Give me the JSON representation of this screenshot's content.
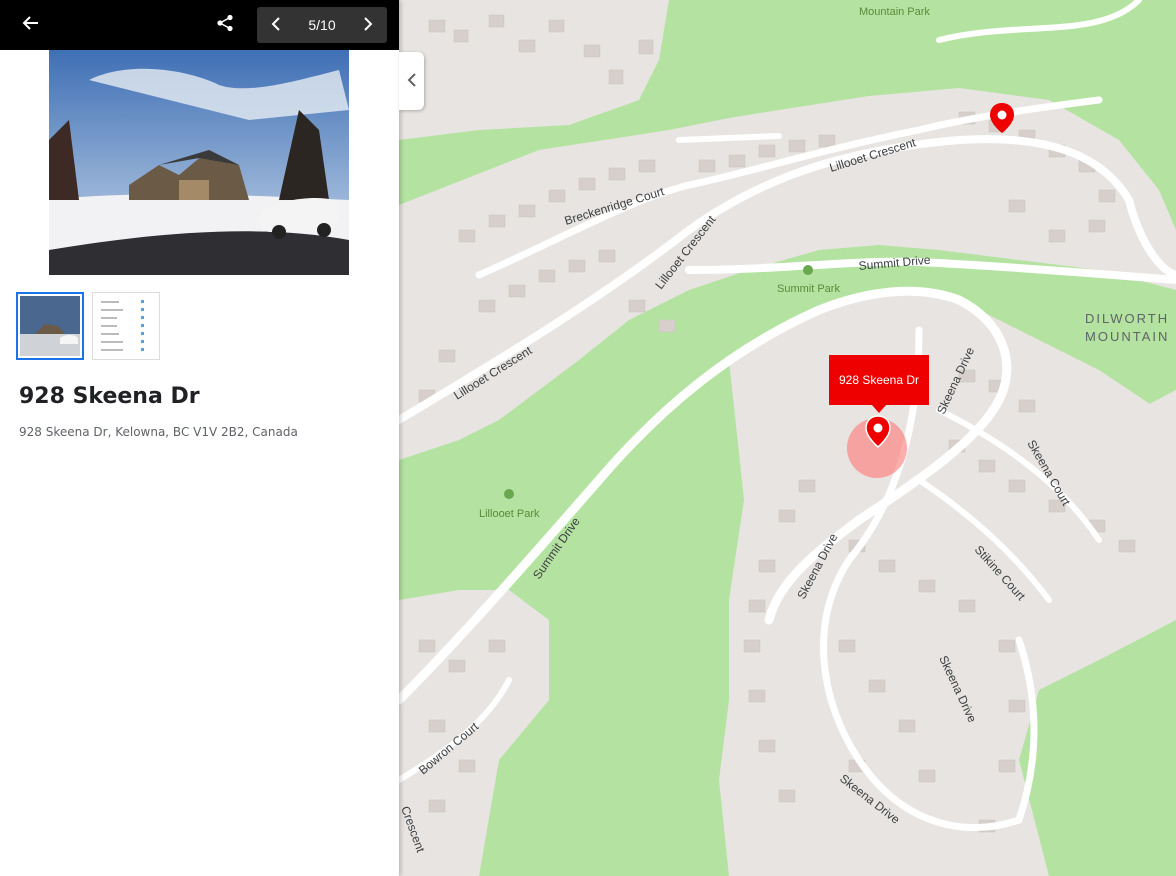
{
  "topbar": {
    "back_icon": "arrow-left-icon",
    "share_icon": "share-icon",
    "pager": {
      "current": "5/10",
      "prev_icon": "chevron-left-icon",
      "next_icon": "chevron-right-icon"
    }
  },
  "listing": {
    "title": "928 Skeena Dr",
    "address": "928 Skeena Dr, Kelowna, BC V1V 2B2, Canada",
    "thumbnails": [
      "photo-thumb",
      "document-thumb"
    ]
  },
  "map": {
    "callout_label": "928 Skeena Dr",
    "roads": {
      "lillooet_crescent_top": "Lillooet Crescent",
      "lillooet_crescent_mid": "Lillooet Crescent",
      "lillooet_crescent_low": "Lillooet Crescent",
      "breckenridge": "Breckenridge Court",
      "summit_drive_top": "Summit Drive",
      "summit_drive_low": "Summit Drive",
      "skeena_drive_1": "Skeena Drive",
      "skeena_drive_2": "Skeena Drive",
      "skeena_drive_3": "Skeena Drive",
      "skeena_drive_4": "Skeena Drive",
      "skeena_court": "Skeena Court",
      "stikine_court": "Stikine Court",
      "bowron_court": "Bowron Court",
      "crescent_edge": "Crescent"
    },
    "parks": {
      "mountain_park_top": "Mountain Park",
      "summit_park": "Summit Park",
      "lillooet_park": "Lillooet Park"
    },
    "area": {
      "line1": "DILWORTH",
      "line2": "MOUNTAIN"
    },
    "marker_color": "#e00000"
  },
  "colors": {
    "topbar_bg": "#000000",
    "accent": "#1a73e8",
    "park_green": "#b4e3a1",
    "residential": "#e8e4e1"
  }
}
